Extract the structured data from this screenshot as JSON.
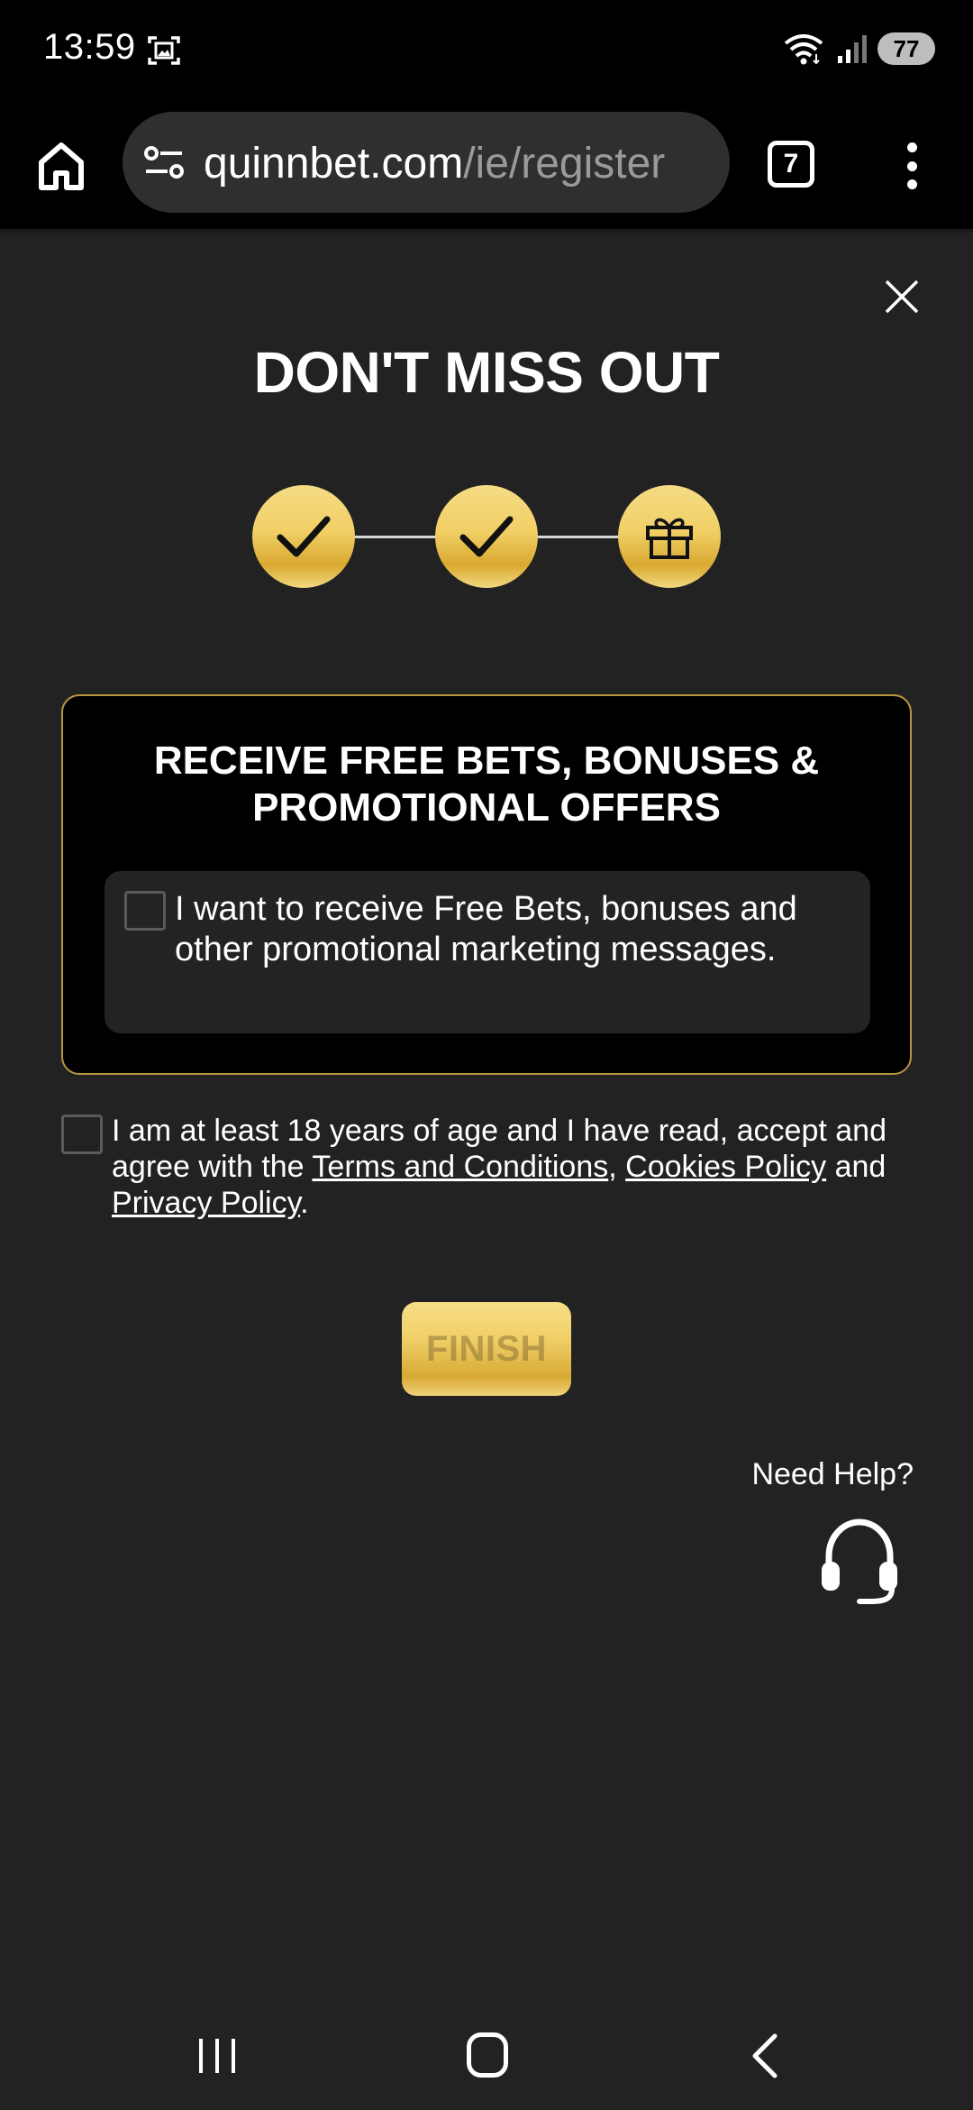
{
  "status_bar": {
    "time": "13:59",
    "battery": "77",
    "icons": [
      "screenshot-icon",
      "wifi-icon",
      "signal-icon"
    ]
  },
  "browser": {
    "url_domain": "quinnbet.com",
    "url_path": "/ie/register",
    "tab_count": "7",
    "icons": [
      "home-icon",
      "tune-icon",
      "more-vert-icon"
    ]
  },
  "page": {
    "title": "DON'T MISS OUT",
    "steps": [
      {
        "state": "complete",
        "icon": "check-icon"
      },
      {
        "state": "complete",
        "icon": "check-icon"
      },
      {
        "state": "current",
        "icon": "gift-icon"
      }
    ],
    "promo": {
      "title_line1": "RECEIVE FREE BETS, BONUSES &",
      "title_line2": "PROMOTIONAL OFFERS",
      "option_text": "I want to receive Free Bets, bonuses and other promotional marketing messages.",
      "checked": false
    },
    "terms": {
      "text_before": "I am at least 18 years of age and I have read, accept and agree with the ",
      "terms_link": "Terms and Conditions",
      "separator": ",  ",
      "cookies_link": "Cookies Policy",
      "and_text": " and ",
      "privacy_link": "Privacy Policy",
      "end": ".",
      "checked": false
    },
    "finish_label": "FINISH",
    "need_help": "Need Help?"
  },
  "colors": {
    "background": "#222222",
    "gold": "#f0cf67",
    "promo_border": "#b8963f"
  }
}
